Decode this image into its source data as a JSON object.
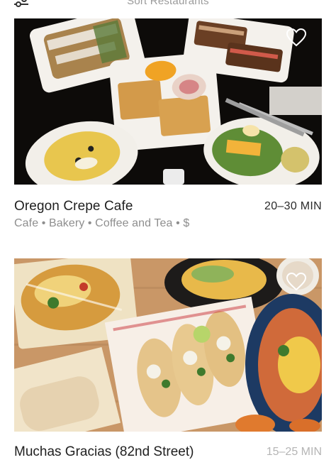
{
  "header": {
    "title": "Sort Restaurants",
    "filter_icon": "sliders-icon"
  },
  "restaurants": [
    {
      "name": "Oregon Crepe Cafe",
      "eta": "20–30 MIN",
      "tags": "Cafe • Bakery • Coffee and Tea • $",
      "favorite_icon": "heart-outline-icon"
    },
    {
      "name": "Muchas Gracias (82nd Street)",
      "eta": "15–25 MIN",
      "favorite_icon": "heart-outline-icon"
    }
  ],
  "colors": {
    "heart": "#ffffff",
    "title_text": "#1f1f1f",
    "secondary_text": "#8e8e8e"
  }
}
